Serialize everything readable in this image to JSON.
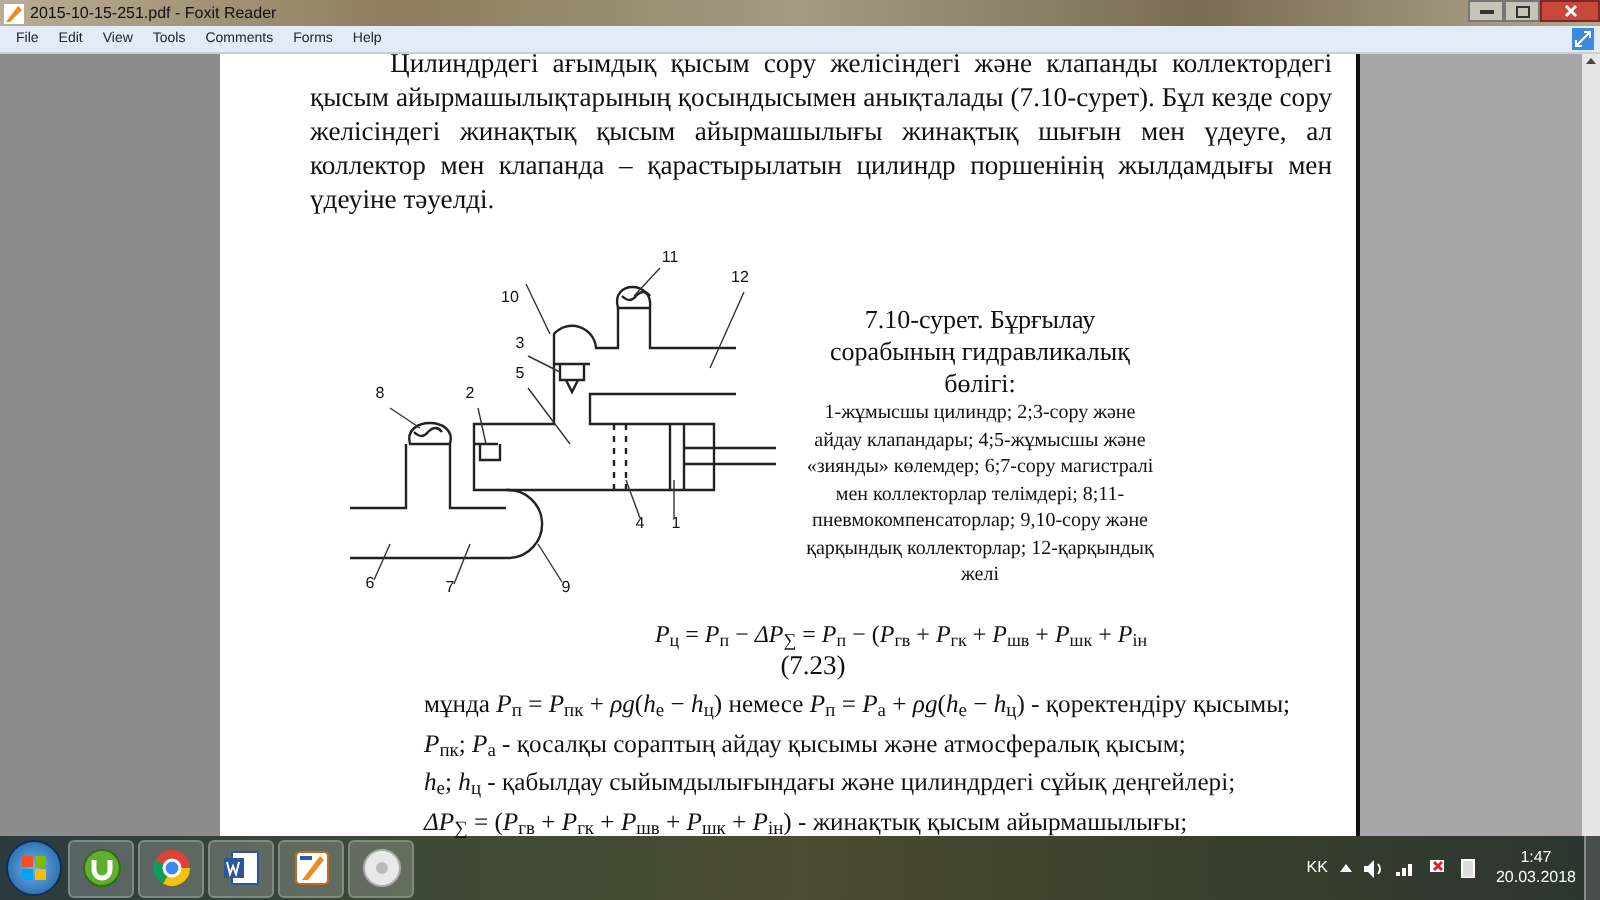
{
  "window": {
    "title": "2015-10-15-251.pdf - Foxit Reader"
  },
  "menu": [
    "File",
    "Edit",
    "View",
    "Tools",
    "Comments",
    "Forms",
    "Help"
  ],
  "document": {
    "paragraph": "Цилиндрдегі ағымдық қысым сору желісіндегі және клапанды коллектордегі қысым айырмашылықтарының қосындысымен анықталады (7.10-сурет). Бұл кезде сору желісіндегі жинақтық қысым айырмашылығы жинақтық шығын мен үдеуге, ал коллектор мен клапанда – қарастырылатын цилиндр поршенінің жылдамдығы мен үдеуіне тәуелді.",
    "figure": {
      "callouts": [
        "1",
        "2",
        "3",
        "4",
        "5",
        "6",
        "7",
        "8",
        "9",
        "10",
        "11",
        "12"
      ],
      "caption_title": "7.10-сурет. Бұрғылау сорабының гидравликалық бөлігі:",
      "caption_legend": "1-жұмысшы цилиндр; 2;3-сору және айдау клапандары; 4;5-жұмысшы және «зиянды» көлемдер; 6;7-сору магистралі мен коллекторлар телімдері; 8;11-пневмокомпенсаторлар; 9,10-сору және қарқындық коллекторлар; 12-қарқындық желі"
    },
    "equation": "*P*$_{ц}$ = *P*$_{п}$ − *ΔP*$_{∑}$ = *P*$_{п}$ − (*P*$_{гв}$ + *P*$_{гк}$ + *P*$_{шв}$ + *P*$_{шк}$ + *P*$_{ін}$",
    "equation_number": "(7.23)",
    "definitions": [
      "мұнда *P*$_{п}$ = *P*$_{пк}$ + *ρg*(*h*$_{е}$ − *h*$_{ц}$) немесе *P*$_{п}$ = *P*$_{а}$ + *ρg*(*h*$_{е}$ − *h*$_{ц}$) - қоректендіру қысымы;",
      "*P*$_{пк}$; *P*$_{а}$ - қосалқы сораптың айдау қысымы және атмосфералық қысым;",
      "*h*$_{е}$; *h*$_{ц}$ - қабылдау сыйымдылығындағы және цилиндрдегі сұйық деңгейлері;",
      "*ΔP*$_{∑}$ = (*P*$_{гв}$ + *P*$_{гк}$ + *P*$_{шв}$ + *P*$_{шк}$ + *P*$_{ін}$) - жинақтық қысым айырмашылығы;"
    ]
  },
  "taskbar": {
    "apps": [
      {
        "kind": "torrent"
      },
      {
        "kind": "browser"
      },
      {
        "kind": "word"
      },
      {
        "kind": "reader"
      },
      {
        "kind": "media"
      }
    ],
    "language": "KK",
    "time": "1:47",
    "date": "20.03.2018"
  }
}
